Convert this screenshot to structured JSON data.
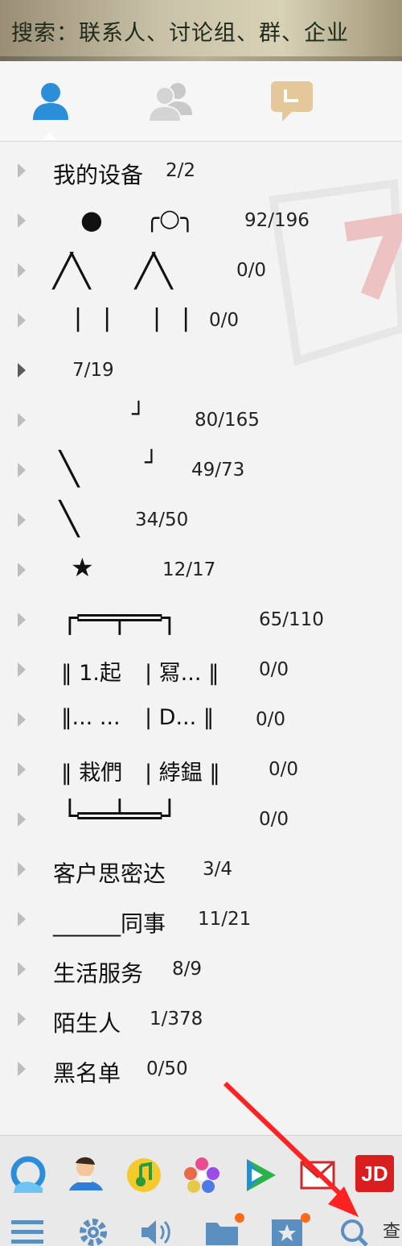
{
  "search": {
    "placeholder": "搜索：联系人、讨论组、群、企业"
  },
  "tabs": [
    {
      "name": "contacts",
      "icon": "person-icon",
      "active": true
    },
    {
      "name": "groups",
      "icon": "group-icon",
      "active": false
    },
    {
      "name": "sessions",
      "icon": "chat-icon",
      "active": false
    }
  ],
  "groups": [
    {
      "label": "我的设备",
      "count": "2/2"
    },
    {
      "glyph_a": "●",
      "glyph_b": "╭○╮",
      "count": "92/196"
    },
    {
      "glyph_a": "╱╲",
      "glyph_b": "╱╲",
      "count": "0/0"
    },
    {
      "glyph_a": "| |",
      "glyph_b": "| |",
      "count": "0/0"
    },
    {
      "count": "7/19"
    },
    {
      "glyph_a": "┘",
      "count": "80/165"
    },
    {
      "glyph_a": "╲",
      "glyph_b": "┘",
      "count": "49/73"
    },
    {
      "glyph_a": "╲",
      "count": "34/50"
    },
    {
      "glyph_a": "★",
      "count": "12/17"
    },
    {
      "glyph_a": "┌══╤══┐",
      "count": "65/110"
    },
    {
      "glyph_a": "‖ 1.起",
      "glyph_b": "| 冩... ‖",
      "count": "0/0"
    },
    {
      "glyph_a": "‖... ...",
      "glyph_b": "| D... ‖",
      "count": "0/0"
    },
    {
      "glyph_a": "‖ 栽們",
      "glyph_b": "| 綍鎾 ‖",
      "count": "0/0"
    },
    {
      "glyph_a": "└══╧══┘",
      "count": "0/0"
    },
    {
      "label": "客户思密达",
      "count": "3/4"
    },
    {
      "label": "______同事",
      "count": "11/21"
    },
    {
      "label": "生活服务",
      "count": "8/9"
    },
    {
      "label": "陌生人",
      "count": "1/378"
    },
    {
      "label": "黑名单",
      "count": "0/50"
    }
  ],
  "apps": [
    {
      "name": "qq-browser-icon"
    },
    {
      "name": "game-character-icon"
    },
    {
      "name": "music-icon"
    },
    {
      "name": "photo-flower-icon"
    },
    {
      "name": "video-play-icon"
    },
    {
      "name": "mail-icon"
    },
    {
      "name": "jd-icon",
      "label": "JD"
    }
  ],
  "tools": [
    {
      "name": "menu-icon"
    },
    {
      "name": "settings-icon"
    },
    {
      "name": "volume-icon"
    },
    {
      "name": "folder-icon"
    },
    {
      "name": "favorites-icon"
    },
    {
      "name": "search-icon"
    }
  ],
  "search_app_label": "查",
  "colors": {
    "accent": "#2a8fd8",
    "notify": "#ff6a1a",
    "annotation_arrow": "#ff2222"
  }
}
